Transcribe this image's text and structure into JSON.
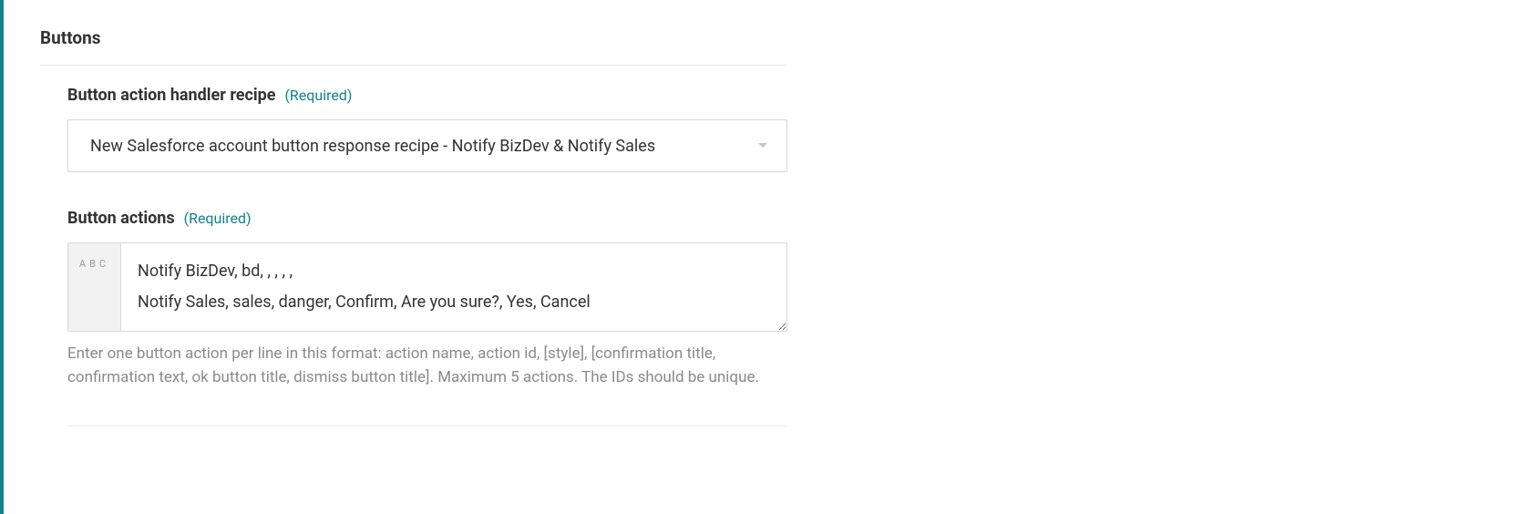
{
  "section": {
    "title": "Buttons"
  },
  "fields": {
    "handler": {
      "label": "Button action handler recipe",
      "required_text": "(Required)",
      "value": "New Salesforce account button response recipe - Notify BizDev & Notify Sales"
    },
    "actions": {
      "label": "Button actions",
      "required_text": "(Required)",
      "prefix": "ABC",
      "value": "Notify BizDev, bd, , , , ,\nNotify Sales, sales, danger, Confirm, Are you sure?, Yes, Cancel",
      "help": "Enter one button action per line in this format: action name, action id, [style], [confirmation title, confirmation text, ok button title, dismiss button title]. Maximum 5 actions. The IDs should be unique."
    }
  }
}
